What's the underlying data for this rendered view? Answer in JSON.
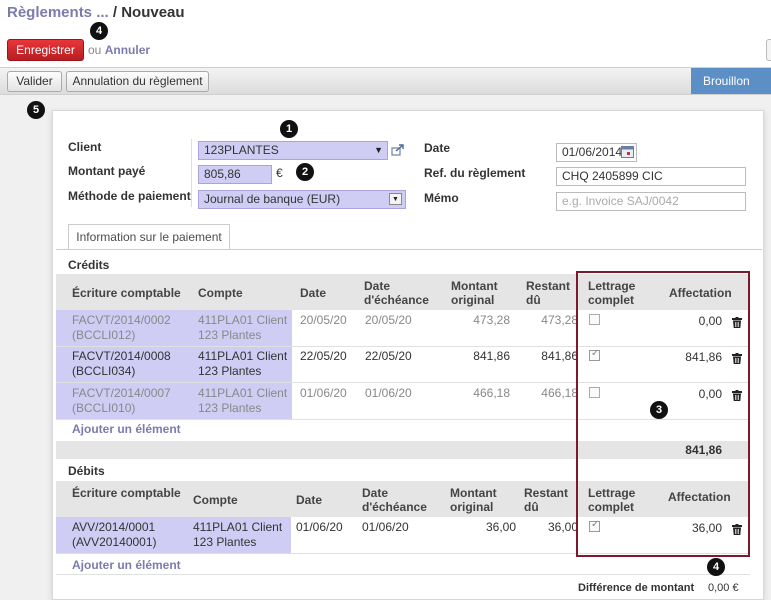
{
  "breadcrumb": {
    "parent": "Règlements ...",
    "sep": " / ",
    "current": "Nouveau"
  },
  "actions": {
    "save": "Enregistrer",
    "or": "ou",
    "cancel": "Annuler"
  },
  "statusbar": {
    "validate": "Valider",
    "cancel_payment": "Annulation du règlement",
    "state": "Brouillon"
  },
  "badges": {
    "b1": "1",
    "b2": "2",
    "b3": "3",
    "b4": "4",
    "b5": "5"
  },
  "form": {
    "client_label": "Client",
    "client_value": "123PLANTES",
    "amount_label": "Montant payé",
    "amount_value": "805,86",
    "currency": "€",
    "method_label": "Méthode de paiement",
    "method_value": "Journal de banque (EUR)",
    "date_label": "Date",
    "date_value": "01/06/2014",
    "ref_label": "Ref. du règlement",
    "ref_value": "CHQ 2405899 CIC",
    "memo_label": "Mémo",
    "memo_placeholder": "e.g. Invoice SAJ/0042"
  },
  "tab": {
    "label": "Information sur le paiement"
  },
  "credits": {
    "title": "Crédits",
    "headers": {
      "entry": "Écriture comptable",
      "account": "Compte",
      "date": "Date",
      "due1": "Date",
      "due2": "d'échéance",
      "orig1": "Montant",
      "orig2": "original",
      "rest1": "Restant",
      "rest2": "dû",
      "full1": "Lettrage",
      "full2": "complet",
      "alloc": "Affectation"
    },
    "rows": [
      {
        "entry1": "FACVT/2014/0002",
        "entry2": "(BCCLI012)",
        "acc1": "411PLA01 Client",
        "acc2": "123 Plantes",
        "date": "20/05/20",
        "due": "20/05/20",
        "orig": "473,28",
        "rest": "473,28",
        "alloc": "0,00"
      },
      {
        "entry1": "FACVT/2014/0008",
        "entry2": "(BCCLI034)",
        "acc1": "411PLA01 Client",
        "acc2": "123 Plantes",
        "date": "22/05/20",
        "due": "22/05/20",
        "orig": "841,86",
        "rest": "841,86",
        "alloc": "841,86"
      },
      {
        "entry1": "FACVT/2014/0007",
        "entry2": "(BCCLI010)",
        "acc1": "411PLA01 Client",
        "acc2": "123 Plantes",
        "date": "01/06/20",
        "due": "01/06/20",
        "orig": "466,18",
        "rest": "466,18",
        "alloc": "0,00"
      }
    ],
    "add": "Ajouter un élément",
    "total": "841,86"
  },
  "debits": {
    "title": "Débits",
    "headers": {
      "entry": "Écriture comptable",
      "account": "Compte",
      "date": "Date",
      "due1": "Date",
      "due2": "d'échéance",
      "orig1": "Montant",
      "orig2": "original",
      "rest1": "Restant",
      "rest2": "dû",
      "full1": "Lettrage",
      "full2": "complet",
      "alloc": "Affectation"
    },
    "rows": [
      {
        "entry1": "AVV/2014/0001",
        "entry2": "(AVV20140001)",
        "acc1": "411PLA01 Client",
        "acc2": "123 Plantes",
        "date": "01/06/20",
        "due": "01/06/20",
        "orig": "36,00",
        "rest": "36,00",
        "alloc": "36,00"
      }
    ],
    "add": "Ajouter un élément"
  },
  "difference": {
    "label": "Différence de montant",
    "value": "0,00 €"
  },
  "colors": {
    "accent": "#7c7bad",
    "highlight": "#d0cdf5",
    "primary": "#c9272b",
    "state": "#5d8fc7",
    "box": "#7a1a2c"
  },
  "icons": {
    "external": "external-link-icon",
    "calendar": "calendar-icon",
    "trash": "trash-icon",
    "dropdown": "dropdown-arrow-icon"
  }
}
